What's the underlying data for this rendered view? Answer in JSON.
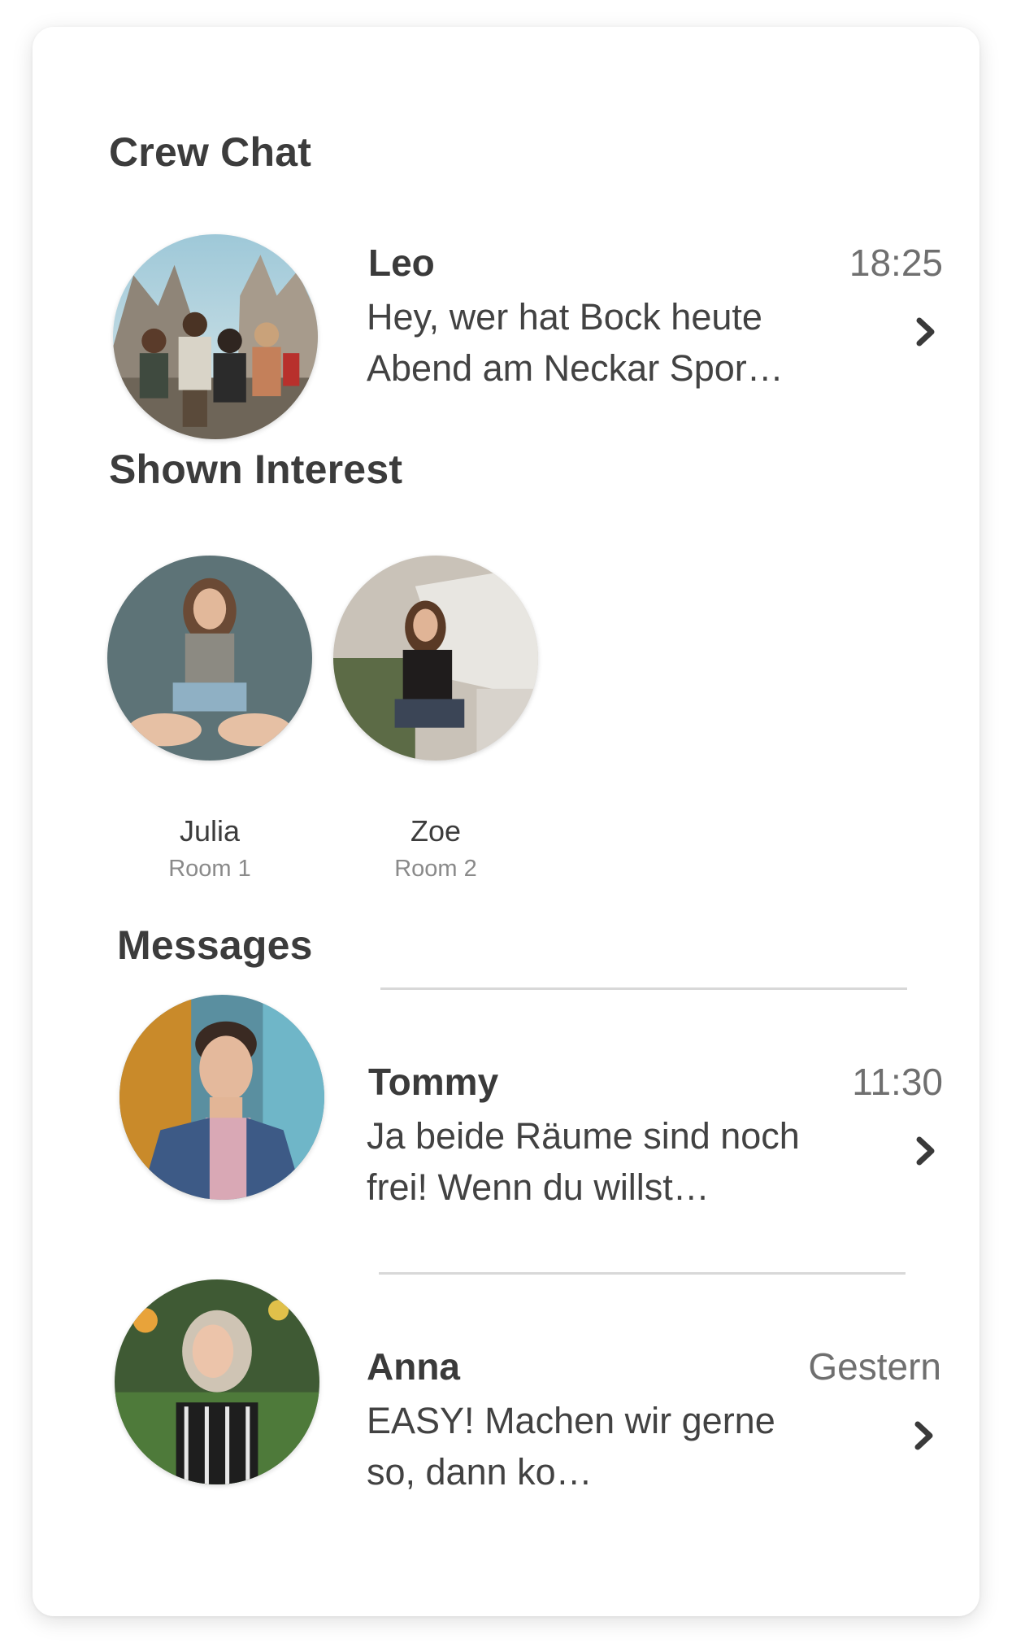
{
  "sections": {
    "crew_chat": "Crew Chat",
    "shown_interest": "Shown Interest",
    "messages": "Messages"
  },
  "crew_chat": {
    "name": "Leo",
    "time": "18:25",
    "preview": "Hey, wer hat Bock heute Abend am Neckar Spor…"
  },
  "interested": [
    {
      "name": "Julia",
      "room": "Room 1"
    },
    {
      "name": "Zoe",
      "room": "Room 2"
    }
  ],
  "messages": [
    {
      "name": "Tommy",
      "time": "11:30",
      "preview": "Ja beide Räume sind noch frei! Wenn du willst…"
    },
    {
      "name": "Anna",
      "time": "Gestern",
      "preview": "EASY! Machen wir gerne so, dann ko…"
    }
  ],
  "icons": {
    "chevron": "chevron-right-icon"
  },
  "colors": {
    "text_primary": "#3a3a3a",
    "text_secondary": "#6f6f6f",
    "divider": "#d8d8d8"
  }
}
